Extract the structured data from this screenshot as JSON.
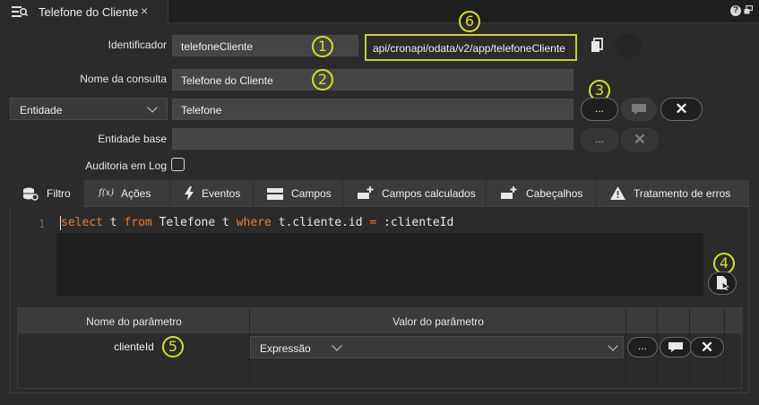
{
  "tab": {
    "title": "Telefone do Cliente",
    "close": "×",
    "icon": "query-icon"
  },
  "window_controls": {
    "help": "?",
    "restore_icon": "restore-icon"
  },
  "form": {
    "identificador_label": "Identificador",
    "identificador_value": "telefoneCliente",
    "endpoint": "api/cronapi/odata/v2/app/telefoneCliente",
    "nome_label": "Nome da consulta",
    "nome_value": "Telefone do Cliente",
    "tipo_select": "Entidade",
    "entidade_value": "Telefone",
    "entidade_base_label": "Entidade base",
    "entidade_base_value": "",
    "auditoria_label": "Auditoria em Log",
    "auditoria_checked": false
  },
  "buttons": {
    "ellipsis": "...",
    "clear": "✕"
  },
  "markers": [
    "1",
    "2",
    "3",
    "4",
    "5",
    "6"
  ],
  "tabs": [
    {
      "label": "Filtro",
      "icon": "database-filter-icon"
    },
    {
      "label": "Ações",
      "icon": "function-icon"
    },
    {
      "label": "Eventos",
      "icon": "lightning-icon"
    },
    {
      "label": "Campos",
      "icon": "columns-icon"
    },
    {
      "label": "Campos calculados",
      "icon": "add-field-icon"
    },
    {
      "label": "Cabeçalhos",
      "icon": "add-header-icon"
    },
    {
      "label": "Tratamento de erros",
      "icon": "warning-icon"
    }
  ],
  "editor": {
    "line_number": "1",
    "tokens": [
      {
        "text": "select",
        "type": "kw"
      },
      {
        "text": " t ",
        "type": "tx"
      },
      {
        "text": "from",
        "type": "kw"
      },
      {
        "text": " Telefone t ",
        "type": "tx"
      },
      {
        "text": "where",
        "type": "kw"
      },
      {
        "text": " t.cliente.id ",
        "type": "tx"
      },
      {
        "text": "=",
        "type": "kw"
      },
      {
        "text": " :clienteId",
        "type": "tx"
      }
    ]
  },
  "params": {
    "col_name": "Nome do parâmetro",
    "col_value": "Valor do parâmetro",
    "rows": [
      {
        "name": "clienteId",
        "type": "Expressão"
      }
    ]
  },
  "colors": {
    "marker": "#d7e31c",
    "keyword": "#f07a2a",
    "endpoint_border": "#c9cf2d"
  }
}
